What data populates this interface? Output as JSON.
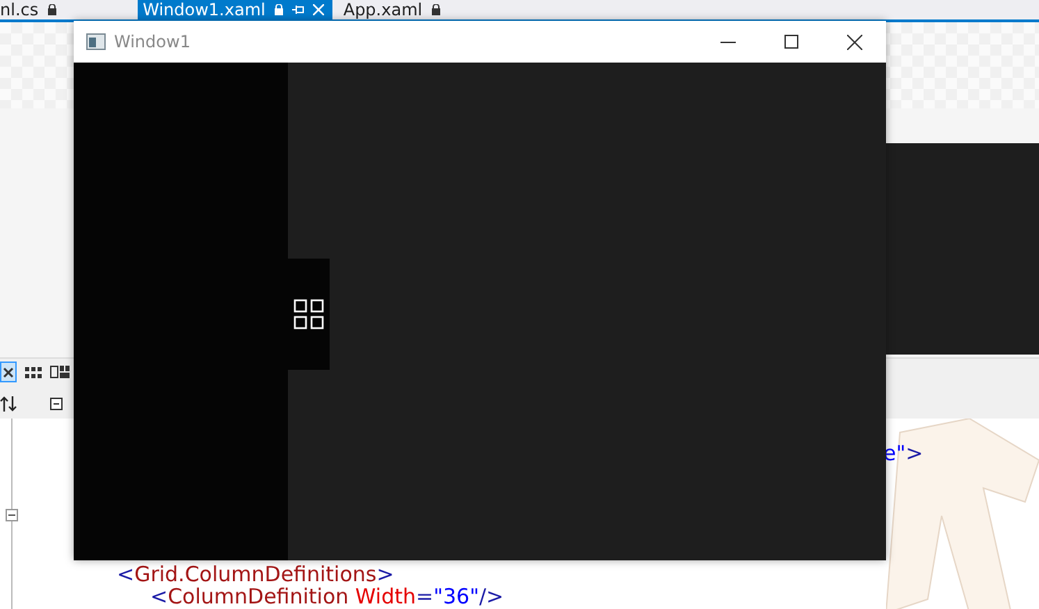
{
  "ide_tabs": [
    {
      "label": "nl.cs",
      "selected": false
    },
    {
      "label": "Window1.xaml",
      "selected": true
    },
    {
      "label": "App.xaml",
      "selected": false
    }
  ],
  "code_fragment": [
    {
      "kind": "value",
      "text": "e\""
    },
    {
      "kind": "punct",
      "text": ">"
    }
  ],
  "code_lines": [
    {
      "tokens": [
        {
          "kind": "punct",
          "text": "<"
        },
        {
          "kind": "element",
          "text": "Grid.ColumnDefinitions"
        },
        {
          "kind": "punct",
          "text": ">"
        }
      ],
      "children": [
        {
          "tokens": [
            {
              "kind": "punct",
              "text": "<"
            },
            {
              "kind": "element",
              "text": "ColumnDefinition"
            },
            {
              "kind": "attr",
              "text": " Width"
            },
            {
              "kind": "punct",
              "text": "="
            },
            {
              "kind": "value",
              "text": "\"36\""
            },
            {
              "kind": "punct",
              "text": "/>"
            }
          ]
        }
      ]
    }
  ],
  "window": {
    "title": "Window1"
  }
}
